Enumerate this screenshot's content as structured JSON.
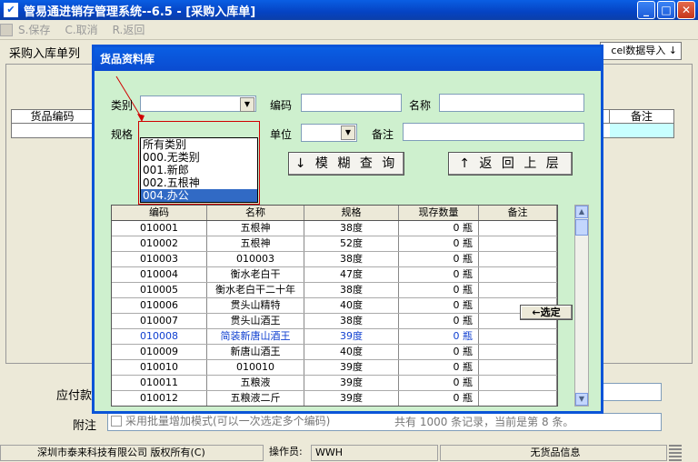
{
  "window": {
    "title": "管易通进销存管理系统--6.5 - [采购入库单]"
  },
  "toolbar": {
    "items": [
      {
        "label": "S.保存"
      },
      {
        "label": "C.取消"
      },
      {
        "label": "R.返回"
      }
    ]
  },
  "main": {
    "tab_title": "采购入库单列",
    "import_label": "cel数据导入 ↓",
    "table_headers": [
      "货品编码",
      "备注"
    ],
    "payable_label": "应付款",
    "note_label": "附注"
  },
  "status_bar": {
    "company": "深圳市泰来科技有限公司 版权所有(C)",
    "operator_label": "操作员:",
    "operator": "WWH",
    "info": "无货品信息"
  },
  "dialog": {
    "title": "货品资料库",
    "category_label": "类别",
    "code_label": "编码",
    "name_label": "名称",
    "spec_label": "规格",
    "unit_label": "单位",
    "remark_label": "备注",
    "search_button": "↓ 模 糊 查 询",
    "back_button": "↑ 返 回 上 层",
    "category_options": [
      "所有类别",
      "000.无类别",
      "001.新郎",
      "002.五根神",
      "004.办公"
    ],
    "selected_category_index": 4,
    "grid_headers": [
      "编码",
      "名称",
      "规格",
      "现存数量",
      "备注"
    ],
    "rows": [
      [
        "010001",
        "五根神",
        "38度",
        "0 瓶",
        ""
      ],
      [
        "010002",
        "五根神",
        "52度",
        "0 瓶",
        ""
      ],
      [
        "010003",
        "010003",
        "38度",
        "0 瓶",
        ""
      ],
      [
        "010004",
        "衡水老白干",
        "47度",
        "0 瓶",
        ""
      ],
      [
        "010005",
        "衡水老白干二十年",
        "38度",
        "0 瓶",
        ""
      ],
      [
        "010006",
        "贯头山精特",
        "40度",
        "0 瓶",
        ""
      ],
      [
        "010007",
        "贯头山酒王",
        "38度",
        "0 瓶",
        ""
      ],
      [
        "010008",
        "简装新唐山酒王",
        "39度",
        "0 瓶",
        ""
      ],
      [
        "010009",
        "新唐山酒王",
        "40度",
        "0 瓶",
        ""
      ],
      [
        "010010",
        "010010",
        "39度",
        "0 瓶",
        ""
      ],
      [
        "010011",
        "五粮液",
        "39度",
        "0 瓶",
        ""
      ],
      [
        "010012",
        "五粮液二斤",
        "39度",
        "0 瓶",
        ""
      ]
    ],
    "highlighted_row_index": 7,
    "select_button": "←选定",
    "batch_mode_label": "采用批量增加模式(可以一次选定多个编码)",
    "record_info": "共有 1000 条记录，当前是第 8 条。"
  },
  "colors": {
    "title_blue": "#0a5ee3",
    "dialog_bg": "#cef0ce",
    "selection_blue": "#316ac5",
    "highlight_text": "#1040d0",
    "annotation_red": "#d00000"
  }
}
